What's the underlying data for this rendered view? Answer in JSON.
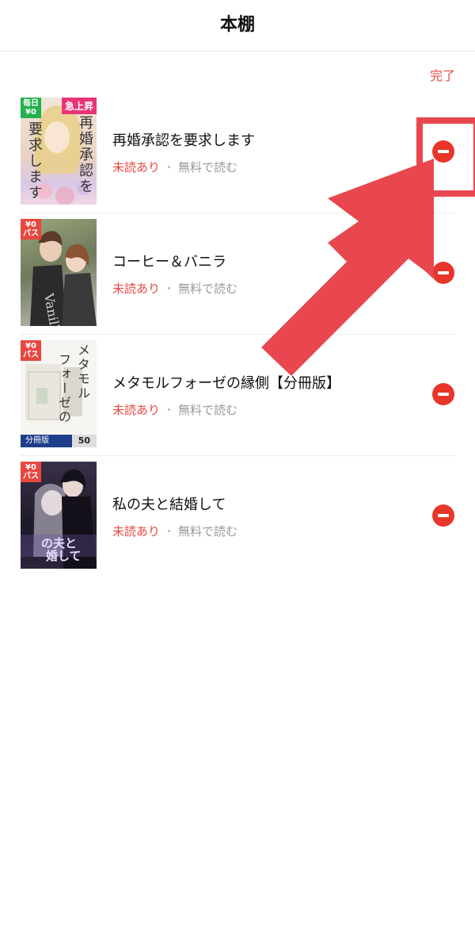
{
  "header": {
    "title": "本棚"
  },
  "toolbar": {
    "done_label": "完了"
  },
  "books": [
    {
      "title": "再婚承認を要求します",
      "unread_label": "未読あり",
      "separator": "・",
      "free_label": "無料で読む",
      "cover": {
        "badge": "毎日\n¥0",
        "tag": "急上昇",
        "vertical_text": "再婚承認を要求します",
        "bg": "#f1e2d5"
      }
    },
    {
      "title": "コーヒー＆バニラ",
      "unread_label": "未読あり",
      "separator": "・",
      "free_label": "無料で読む",
      "cover": {
        "badge": "¥0\nパス",
        "tag": "",
        "vertical_text": "",
        "bg": "#7a8a6e"
      }
    },
    {
      "title": "メタモルフォーゼの縁側【分冊版】",
      "unread_label": "未読あり",
      "separator": "・",
      "free_label": "無料で読む",
      "cover": {
        "badge": "¥0\nパス",
        "tag": "",
        "vertical_text": "メタモルフォーゼの縁側",
        "bg": "#f4f4f0",
        "strip_label": "分冊版",
        "volume": "50"
      }
    },
    {
      "title": "私の夫と結婚して",
      "unread_label": "未読あり",
      "separator": "・",
      "free_label": "無料で読む",
      "cover": {
        "badge": "¥0\nパス",
        "tag": "",
        "vertical_text": "",
        "bg": "#2a2236",
        "overlay_text": "の夫と結婚して"
      }
    }
  ],
  "colors": {
    "accent": "#e8473f",
    "remove": "#e8352a",
    "annotation": "#e8474f"
  },
  "icons": {
    "remove": "minus-circle-icon",
    "annotation": "arrow-icon"
  }
}
